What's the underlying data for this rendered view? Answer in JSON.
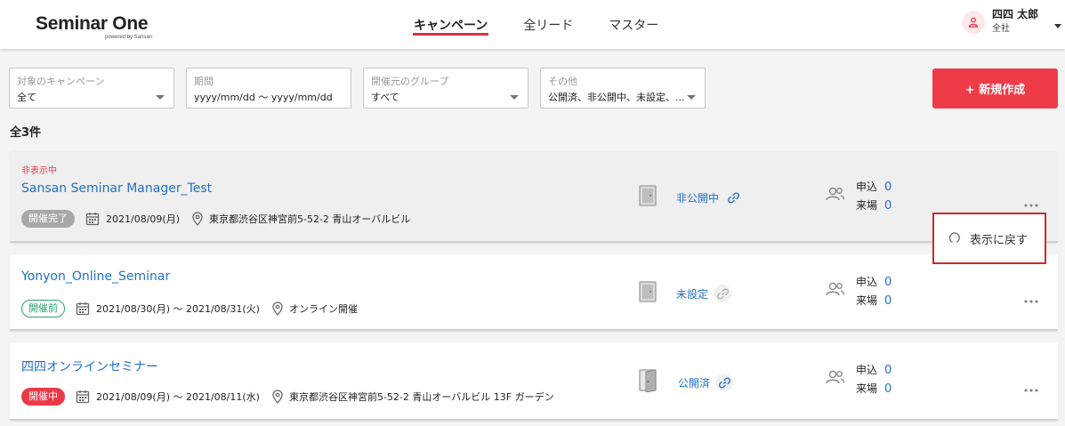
{
  "app": {
    "logo_main": "Seminar One",
    "logo_sub": "powered by Sansan"
  },
  "nav": {
    "items": [
      {
        "label": "キャンペーン",
        "active": true
      },
      {
        "label": "全リード",
        "active": false
      },
      {
        "label": "マスター",
        "active": false
      }
    ]
  },
  "user": {
    "name": "四四 太郎",
    "org": "全社"
  },
  "filters": {
    "campaign": {
      "label": "対象のキャンペーン",
      "value": "全て"
    },
    "period": {
      "label": "期間",
      "value": "yyyy/mm/dd 〜 yyyy/mm/dd"
    },
    "group": {
      "label": "開催元のグループ",
      "value": "すべて"
    },
    "other": {
      "label": "その他",
      "value": "公開済、非公開中、未設定、..."
    }
  },
  "new_button_label": "+ 新規作成",
  "total_label": "全3件",
  "seminars": [
    {
      "hidden_tag": "非表示中",
      "title": "Sansan Seminar Manager_Test",
      "badge": "開催完了",
      "date": "2021/08/09(月)",
      "location": "東京都渋谷区神宮前5-52-2 青山オーバルビル",
      "status": "非公開中",
      "applied_label": "申込",
      "applied": "0",
      "visited_label": "来場",
      "visited": "0"
    },
    {
      "title": "Yonyon_Online_Seminar",
      "badge": "開催前",
      "date": "2021/08/30(月) 〜 2021/08/31(火)",
      "location": "オンライン開催",
      "status": "未設定",
      "applied_label": "申込",
      "applied": "0",
      "visited_label": "来場",
      "visited": "0"
    },
    {
      "title": "四四オンラインセミナー",
      "badge": "開催中",
      "date": "2021/08/09(月) 〜 2021/08/11(水)",
      "location": "東京都渋谷区神宮前5-52-2 青山オーバルビル 13F ガーデン",
      "status": "公開済",
      "applied_label": "申込",
      "applied": "0",
      "visited_label": "来場",
      "visited": "0"
    }
  ],
  "popup": {
    "label": "表示に戻す"
  },
  "colors": {
    "accent": "#ef3b48",
    "link": "#2270c9",
    "popup_border": "#cc2a2a"
  }
}
